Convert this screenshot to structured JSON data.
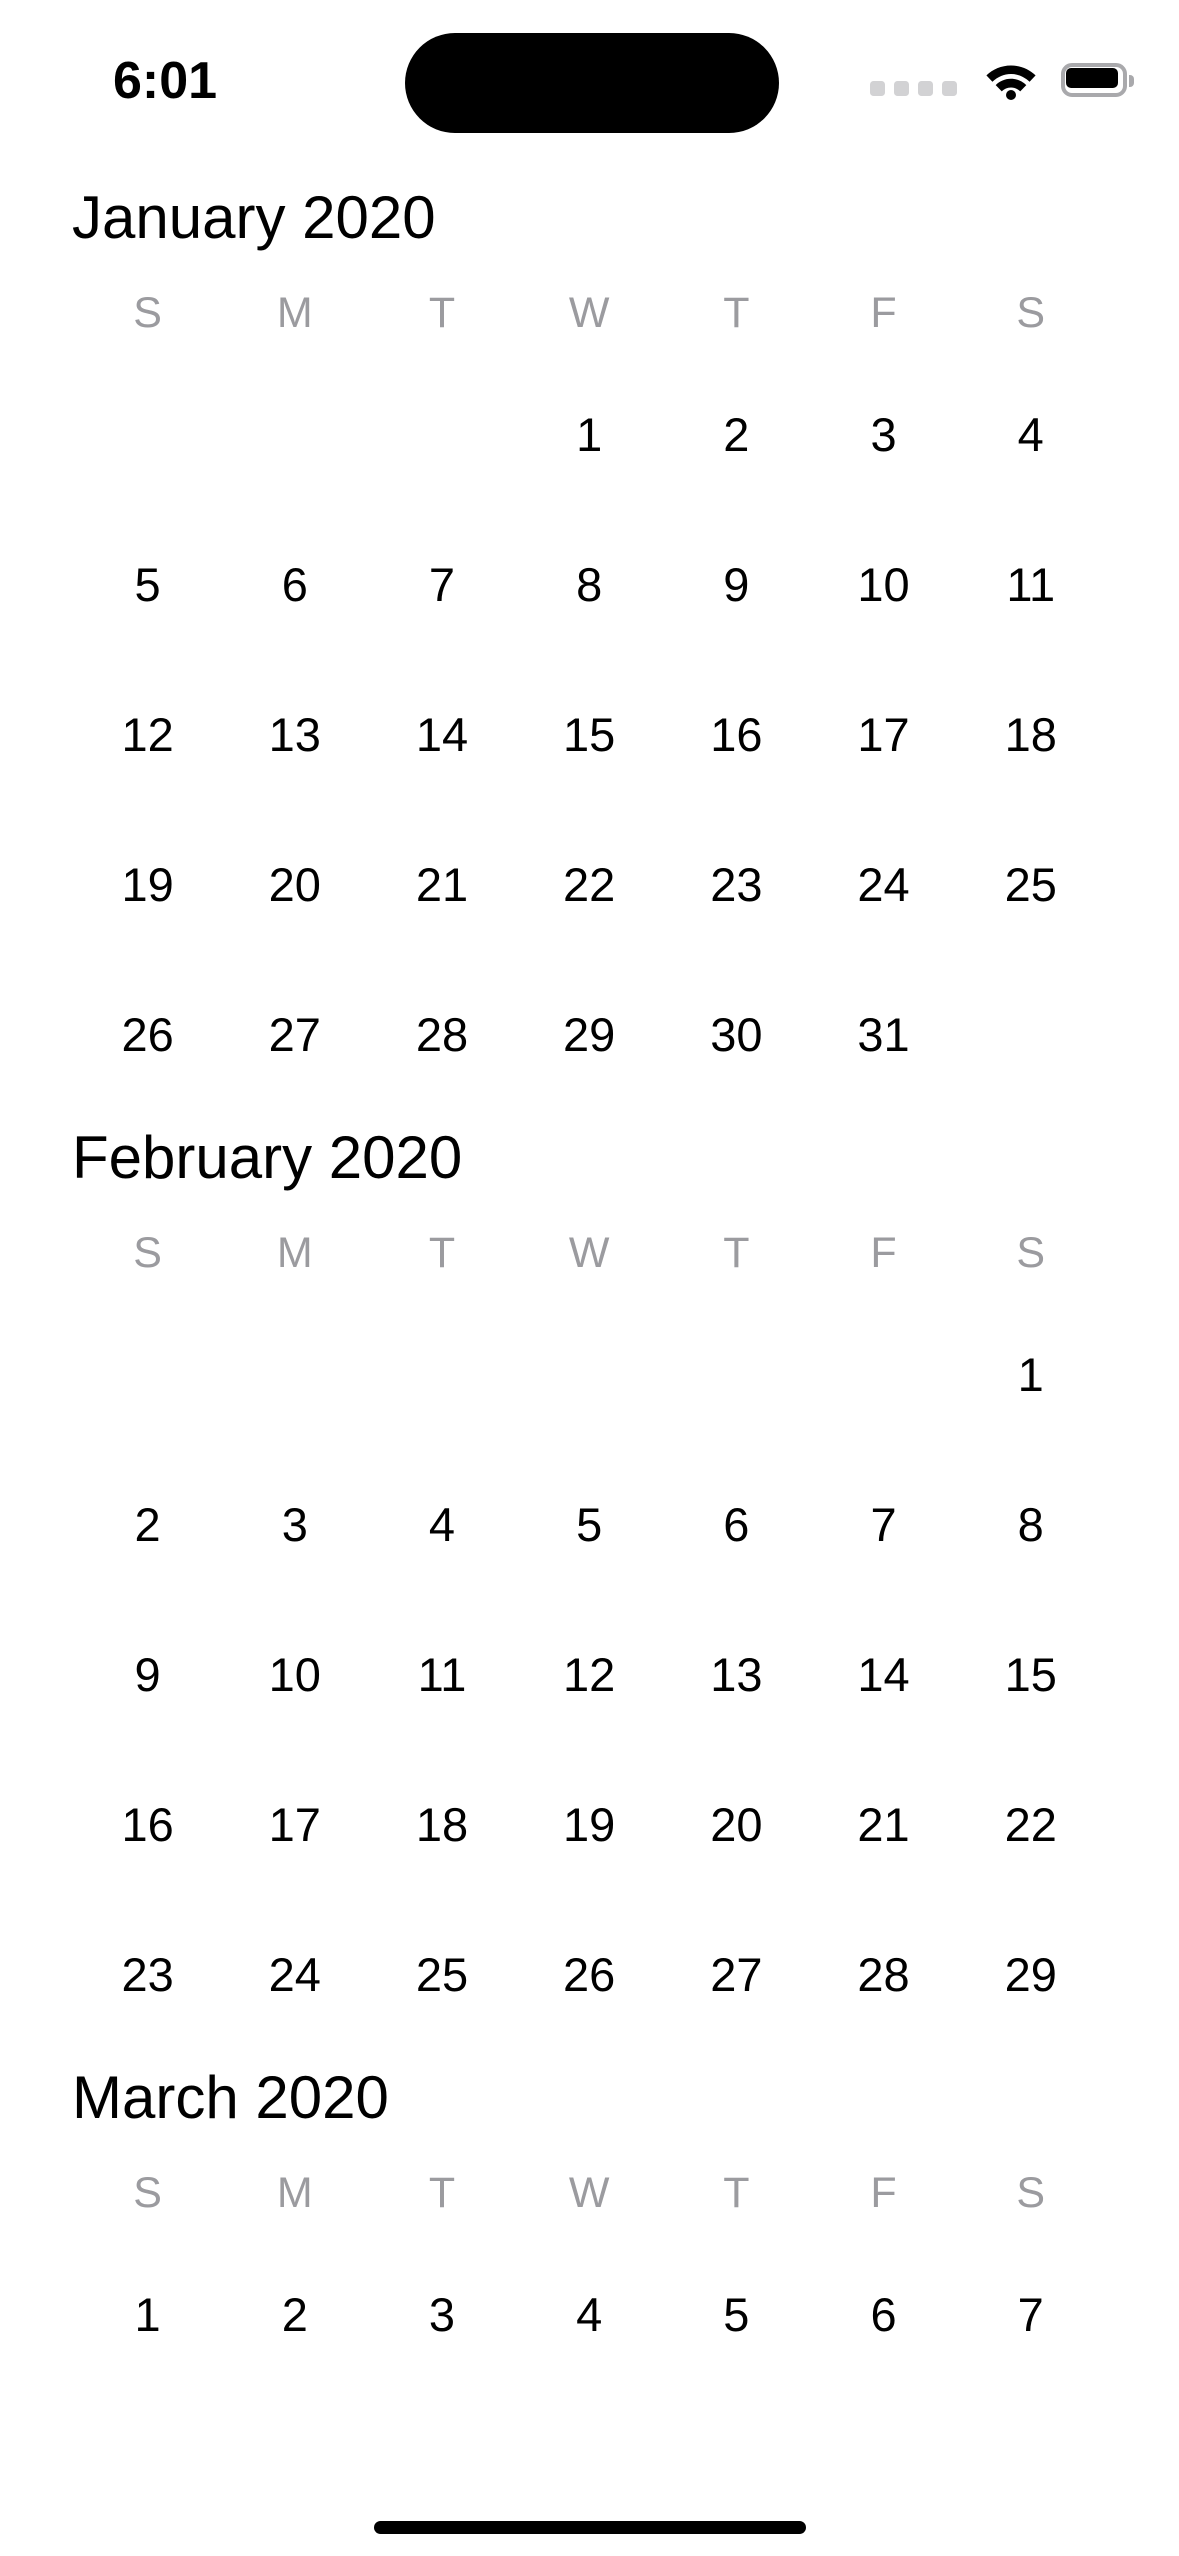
{
  "status_bar": {
    "time": "6:01",
    "cellular_icon": "cellular-signal-dots-icon",
    "cellular_dots": 4,
    "wifi_icon": "wifi-icon",
    "battery_icon": "battery-icon",
    "dynamic_island": "dynamic-island",
    "dot_color": "#d2d2d4",
    "battery_outline_color": "#a9a9ac"
  },
  "app": {
    "name": "Calendar",
    "view": "year-list"
  },
  "colors": {
    "background": "#ffffff",
    "day_number": "#000000",
    "weekday_header": "#9b9b9f",
    "month_title": "#000000",
    "home_indicator": "#000000"
  },
  "weekdays": [
    "S",
    "M",
    "T",
    "W",
    "T",
    "F",
    "S"
  ],
  "months": [
    {
      "title": "January 2020",
      "start_weekday_index": 3,
      "days": [
        "1",
        "2",
        "3",
        "4",
        "5",
        "6",
        "7",
        "8",
        "9",
        "10",
        "11",
        "12",
        "13",
        "14",
        "15",
        "16",
        "17",
        "18",
        "19",
        "20",
        "21",
        "22",
        "23",
        "24",
        "25",
        "26",
        "27",
        "28",
        "29",
        "30",
        "31"
      ]
    },
    {
      "title": "February 2020",
      "start_weekday_index": 6,
      "days": [
        "1",
        "2",
        "3",
        "4",
        "5",
        "6",
        "7",
        "8",
        "9",
        "10",
        "11",
        "12",
        "13",
        "14",
        "15",
        "16",
        "17",
        "18",
        "19",
        "20",
        "21",
        "22",
        "23",
        "24",
        "25",
        "26",
        "27",
        "28",
        "29"
      ]
    },
    {
      "title": "March 2020",
      "start_weekday_index": 0,
      "days": [
        "1",
        "2",
        "3",
        "4",
        "5",
        "6",
        "7"
      ]
    }
  ],
  "home_indicator": "home-indicator"
}
